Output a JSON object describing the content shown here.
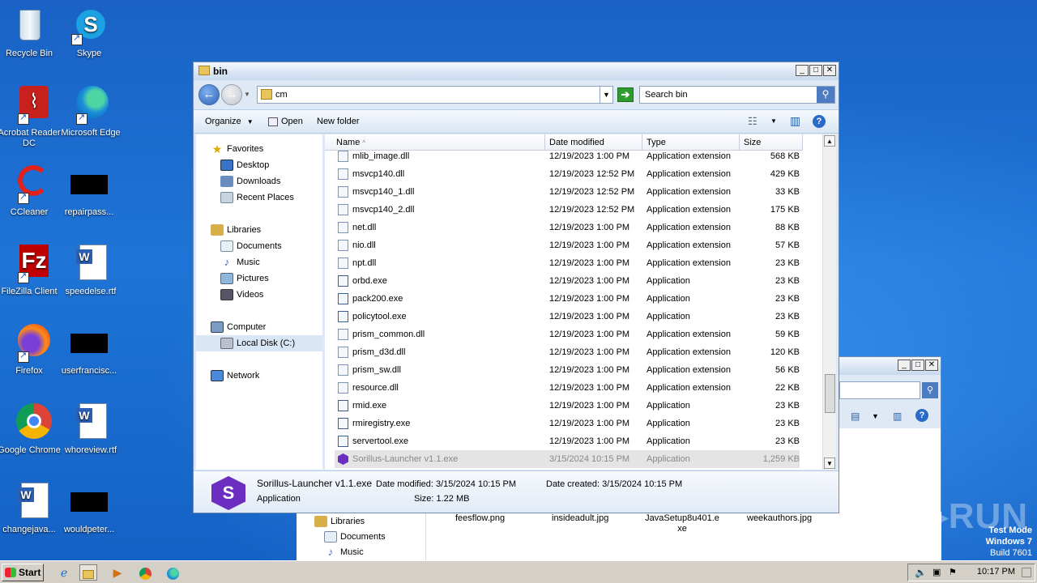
{
  "desktop": {
    "icons": [
      {
        "label": "Recycle Bin"
      },
      {
        "label": "Skype"
      },
      {
        "label": "Acrobat Reader DC"
      },
      {
        "label": "Microsoft Edge"
      },
      {
        "label": "CCleaner"
      },
      {
        "label": "repairpass..."
      },
      {
        "label": "FileZilla Client"
      },
      {
        "label": "speedelse.rtf"
      },
      {
        "label": "Firefox"
      },
      {
        "label": "userfrancisc..."
      },
      {
        "label": "Google Chrome"
      },
      {
        "label": "whoreview.rtf"
      },
      {
        "label": "changejava..."
      },
      {
        "label": "wouldpeter..."
      }
    ]
  },
  "explorer": {
    "title": "bin",
    "address_value": "cm",
    "search_placeholder": "Search bin",
    "toolbar": {
      "organize": "Organize",
      "open": "Open",
      "new_folder": "New folder"
    },
    "nav": {
      "favorites": "Favorites",
      "desktop": "Desktop",
      "downloads": "Downloads",
      "recent": "Recent Places",
      "libraries": "Libraries",
      "documents": "Documents",
      "music": "Music",
      "pictures": "Pictures",
      "videos": "Videos",
      "computer": "Computer",
      "localdisk": "Local Disk (C:)",
      "network": "Network"
    },
    "columns": {
      "name": "Name",
      "date": "Date modified",
      "type": "Type",
      "size": "Size"
    },
    "files": [
      {
        "name": "mlib_image.dll",
        "date": "12/19/2023 1:00 PM",
        "type": "Application extension",
        "size": "568 KB"
      },
      {
        "name": "msvcp140.dll",
        "date": "12/19/2023 12:52 PM",
        "type": "Application extension",
        "size": "429 KB"
      },
      {
        "name": "msvcp140_1.dll",
        "date": "12/19/2023 12:52 PM",
        "type": "Application extension",
        "size": "33 KB"
      },
      {
        "name": "msvcp140_2.dll",
        "date": "12/19/2023 12:52 PM",
        "type": "Application extension",
        "size": "175 KB"
      },
      {
        "name": "net.dll",
        "date": "12/19/2023 1:00 PM",
        "type": "Application extension",
        "size": "88 KB"
      },
      {
        "name": "nio.dll",
        "date": "12/19/2023 1:00 PM",
        "type": "Application extension",
        "size": "57 KB"
      },
      {
        "name": "npt.dll",
        "date": "12/19/2023 1:00 PM",
        "type": "Application extension",
        "size": "23 KB"
      },
      {
        "name": "orbd.exe",
        "date": "12/19/2023 1:00 PM",
        "type": "Application",
        "size": "23 KB"
      },
      {
        "name": "pack200.exe",
        "date": "12/19/2023 1:00 PM",
        "type": "Application",
        "size": "23 KB"
      },
      {
        "name": "policytool.exe",
        "date": "12/19/2023 1:00 PM",
        "type": "Application",
        "size": "23 KB"
      },
      {
        "name": "prism_common.dll",
        "date": "12/19/2023 1:00 PM",
        "type": "Application extension",
        "size": "59 KB"
      },
      {
        "name": "prism_d3d.dll",
        "date": "12/19/2023 1:00 PM",
        "type": "Application extension",
        "size": "120 KB"
      },
      {
        "name": "prism_sw.dll",
        "date": "12/19/2023 1:00 PM",
        "type": "Application extension",
        "size": "56 KB"
      },
      {
        "name": "resource.dll",
        "date": "12/19/2023 1:00 PM",
        "type": "Application extension",
        "size": "22 KB"
      },
      {
        "name": "rmid.exe",
        "date": "12/19/2023 1:00 PM",
        "type": "Application",
        "size": "23 KB"
      },
      {
        "name": "rmiregistry.exe",
        "date": "12/19/2023 1:00 PM",
        "type": "Application",
        "size": "23 KB"
      },
      {
        "name": "servertool.exe",
        "date": "12/19/2023 1:00 PM",
        "type": "Application",
        "size": "23 KB"
      },
      {
        "name": "Sorillus-Launcher v1.1.exe",
        "date": "3/15/2024 10:15 PM",
        "type": "Application",
        "size": "1,259 KB"
      }
    ],
    "details": {
      "name": "Sorillus-Launcher v1.1.exe",
      "type": "Application",
      "modified": "Date modified: 3/15/2024 10:15 PM",
      "size": "Size: 1.22 MB",
      "created": "Date created: 3/15/2024 10:15 PM"
    }
  },
  "bg_window": {
    "nav": {
      "libraries": "Libraries",
      "documents": "Documents",
      "music": "Music"
    },
    "files": [
      "feesflow.png",
      "insideadult.jpg",
      "JavaSetup8u401.e\nxe",
      "weekauthors.jpg"
    ]
  },
  "taskbar": {
    "start": "Start",
    "time": "10:17 PM"
  },
  "watermark": {
    "line1": "Test Mode",
    "line2": "Windows 7",
    "line3": "Build 7601",
    "brand": "ANY▷RUN"
  }
}
